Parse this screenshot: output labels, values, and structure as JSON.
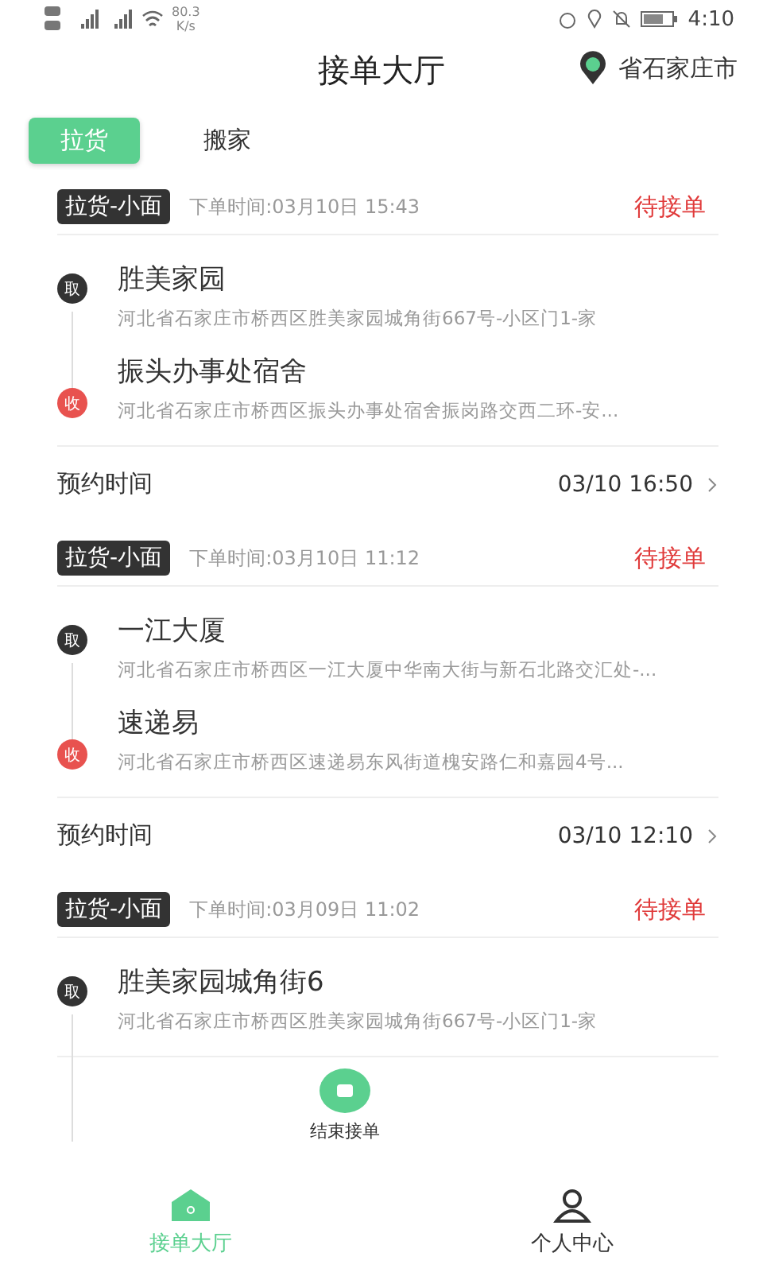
{
  "status_bar": {
    "speed": "80.3",
    "speed_unit": "K/s",
    "time": "4:10"
  },
  "header": {
    "title": "接单大厅",
    "location": "省石家庄市"
  },
  "tabs": [
    {
      "label": "拉货",
      "selected": true
    },
    {
      "label": "搬家",
      "selected": false
    }
  ],
  "orders": [
    {
      "tag": "拉货-小面",
      "order_time": "下单时间:03月10日 15:43",
      "status": "待接单",
      "stops": [
        {
          "kind": "pickup",
          "badge": "取",
          "name": "胜美家园",
          "address": "河北省石家庄市桥西区胜美家园城角街667号-小区门1-家"
        },
        {
          "kind": "delivery",
          "badge": "收",
          "name": "振头办事处宿舍",
          "address": "河北省石家庄市桥西区振头办事处宿舍振岗路交西二环-安..."
        }
      ],
      "appointment_label": "预约时间",
      "appointment": "03/10 16:50"
    },
    {
      "tag": "拉货-小面",
      "order_time": "下单时间:03月10日 11:12",
      "status": "待接单",
      "stops": [
        {
          "kind": "pickup",
          "badge": "取",
          "name": "一江大厦",
          "address": "河北省石家庄市桥西区一江大厦中华南大街与新石北路交汇处-..."
        },
        {
          "kind": "delivery",
          "badge": "收",
          "name": "速递易",
          "address": "河北省石家庄市桥西区速递易东风街道槐安路仁和嘉园4号..."
        }
      ],
      "appointment_label": "预约时间",
      "appointment": "03/10 12:10"
    },
    {
      "tag": "拉货-小面",
      "order_time": "下单时间:03月09日 11:02",
      "status": "待接单",
      "stops": [
        {
          "kind": "pickup",
          "badge": "取",
          "name": "胜美家园城角街6",
          "address": "河北省石家庄市桥西区胜美家园城角街667号-小区门1-家"
        }
      ]
    }
  ],
  "float_button": {
    "label": "结束接单"
  },
  "nav": [
    {
      "label": "接单大厅",
      "selected": true
    },
    {
      "label": "个人中心",
      "selected": false
    }
  ]
}
